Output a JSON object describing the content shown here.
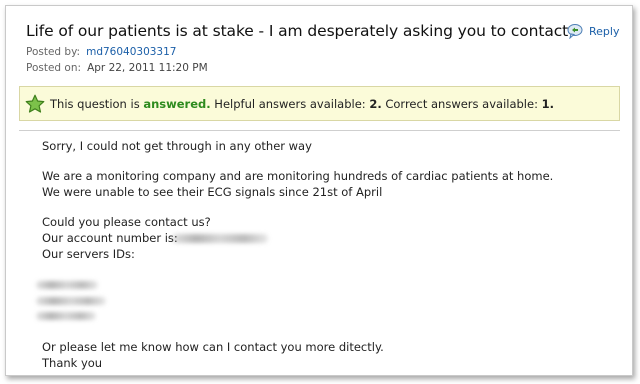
{
  "post": {
    "title": "Life of our patients is at stake - I am desperately asking you to contact",
    "reply_label": "Reply",
    "posted_by_label": "Posted by:",
    "posted_by_value": "md76040303317",
    "posted_on_label": "Posted on:",
    "posted_on_value": "Apr 22, 2011 11:20 PM"
  },
  "status": {
    "prefix": "This question is",
    "state": "answered.",
    "helpful_label": "Helpful answers available:",
    "helpful_count": "2.",
    "correct_label": "Correct answers available:",
    "correct_count": "1.",
    "highlight_color": "#2e8b1e",
    "background_color": "#fbfbd9"
  },
  "message": {
    "line1": "Sorry, I could not get through in any other way",
    "line2": "We are a monitoring company and are monitoring hundreds of cardiac patients at home.",
    "line3": "We were unable to see their ECG signals since 21st of April",
    "line4": "Could you please contact us?",
    "line5": "Our account number is:",
    "line6": "Our servers IDs:",
    "line7": "Or please let me know how can I contact you more ditectly.",
    "line8": "Thank you"
  },
  "icons": {
    "reply": "reply-icon",
    "status": "star-icon"
  },
  "colors": {
    "link": "#1b5fa8"
  }
}
